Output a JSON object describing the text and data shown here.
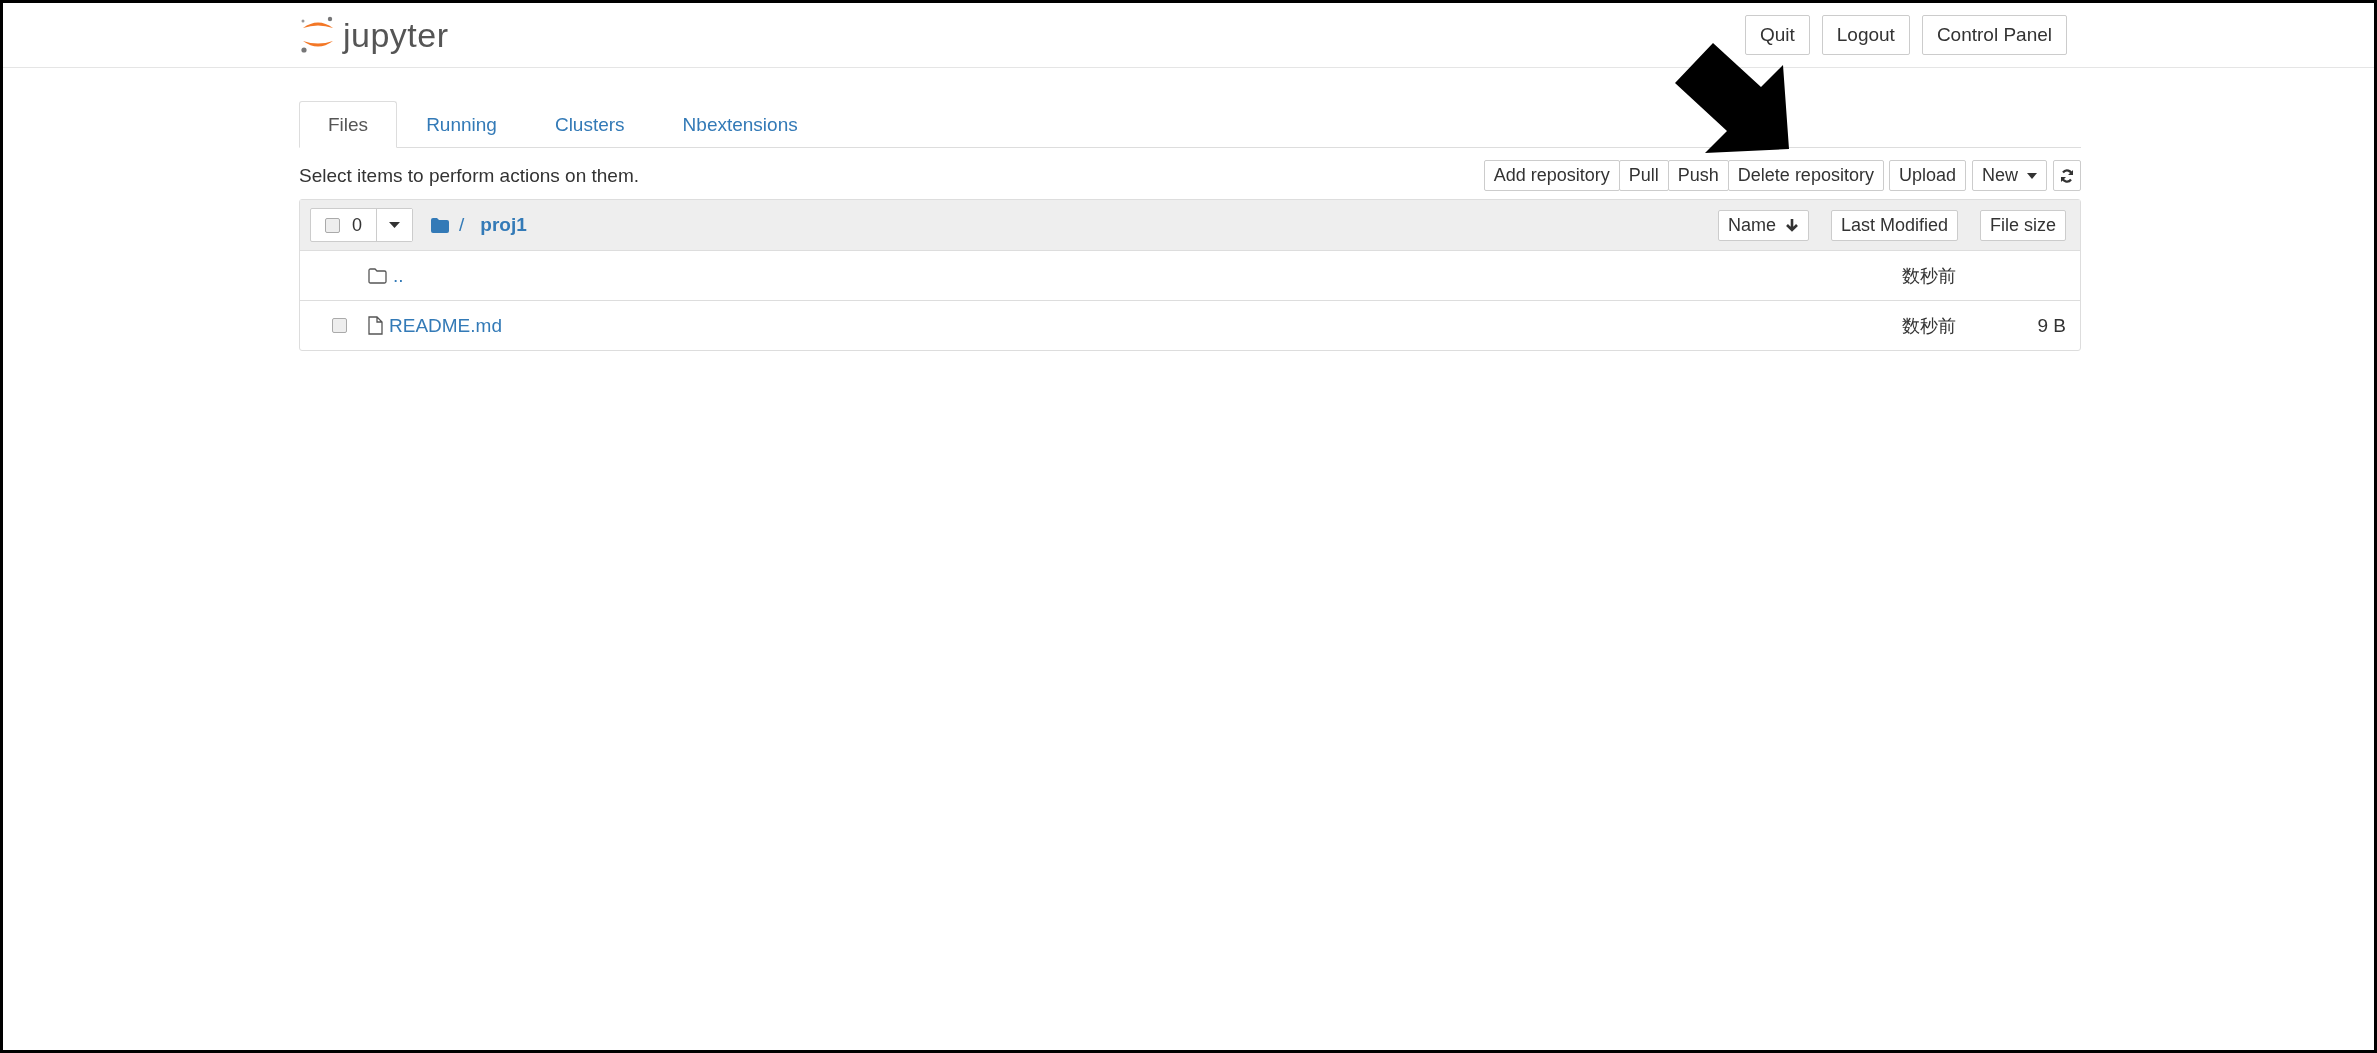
{
  "header": {
    "logo_text": "jupyter",
    "buttons": [
      "Quit",
      "Logout",
      "Control Panel"
    ]
  },
  "tabs": [
    {
      "label": "Files",
      "selected": true
    },
    {
      "label": "Running",
      "selected": false
    },
    {
      "label": "Clusters",
      "selected": false
    },
    {
      "label": "Nbextensions",
      "selected": false
    }
  ],
  "toolbar": {
    "hint": "Select items to perform actions on them.",
    "button_groups": [
      [
        "Add repository",
        "Pull",
        "Push",
        "Delete repository"
      ],
      [
        "Upload"
      ]
    ],
    "new_button": "New"
  },
  "list_header": {
    "select_count": "0",
    "select_all_checked": false,
    "breadcrumb": [
      "/",
      "proj1"
    ],
    "sort_buttons": [
      {
        "label": "Name",
        "sorted": true
      },
      {
        "label": "Last Modified",
        "sorted": false
      },
      {
        "label": "File size",
        "sorted": false
      }
    ]
  },
  "rows": [
    {
      "kind": "parent",
      "name": "..",
      "modified": "数秒前"
    },
    {
      "kind": "file",
      "name": "README.md",
      "modified": "数秒前",
      "size": "9 B",
      "checked": false
    }
  ]
}
